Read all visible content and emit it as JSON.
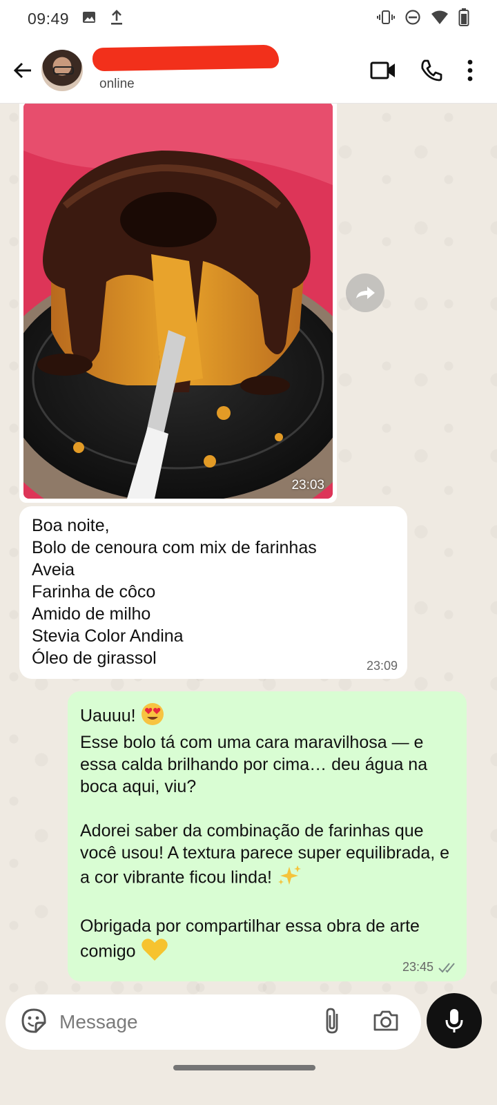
{
  "status_bar": {
    "time": "09:49",
    "icons": [
      "gallery-icon",
      "upload-icon",
      "vibrate-icon",
      "do-not-disturb-icon",
      "wifi-icon",
      "battery-icon"
    ]
  },
  "header": {
    "contact_name": "",
    "status": "online",
    "actions": [
      "video-call-icon",
      "phone-icon",
      "more-options-icon"
    ]
  },
  "messages": {
    "image_message": {
      "time": "23:03",
      "description_icon": "cake-photo"
    },
    "incoming": {
      "lines": [
        "Boa noite,",
        "Bolo de cenoura com mix de farinhas",
        "Aveia",
        "Farinha de côco",
        "Amido de milho",
        "Stevia Color Andina",
        "Óleo de girassol"
      ],
      "time": "23:09"
    },
    "outgoing": {
      "p1_line1": "Uauuu!",
      "p1_rest": "Esse bolo tá com uma cara maravilhosa — e essa calda brilhando por cima… deu água na boca aqui, viu?",
      "p2": "Adorei saber da combinação de farinhas que você usou! A textura parece super equilibrada, e a cor vibrante ficou linda!",
      "p3": "Obrigada por compartilhar essa obra de arte comigo",
      "time": "23:45",
      "status": "read"
    }
  },
  "composer": {
    "placeholder": "Message"
  },
  "colors": {
    "chat_bg": "#efeae2",
    "incoming_bubble": "#ffffff",
    "outgoing_bubble": "#d9fdd3",
    "redaction": "#f2301b",
    "read_ticks": "#53bdeb"
  }
}
